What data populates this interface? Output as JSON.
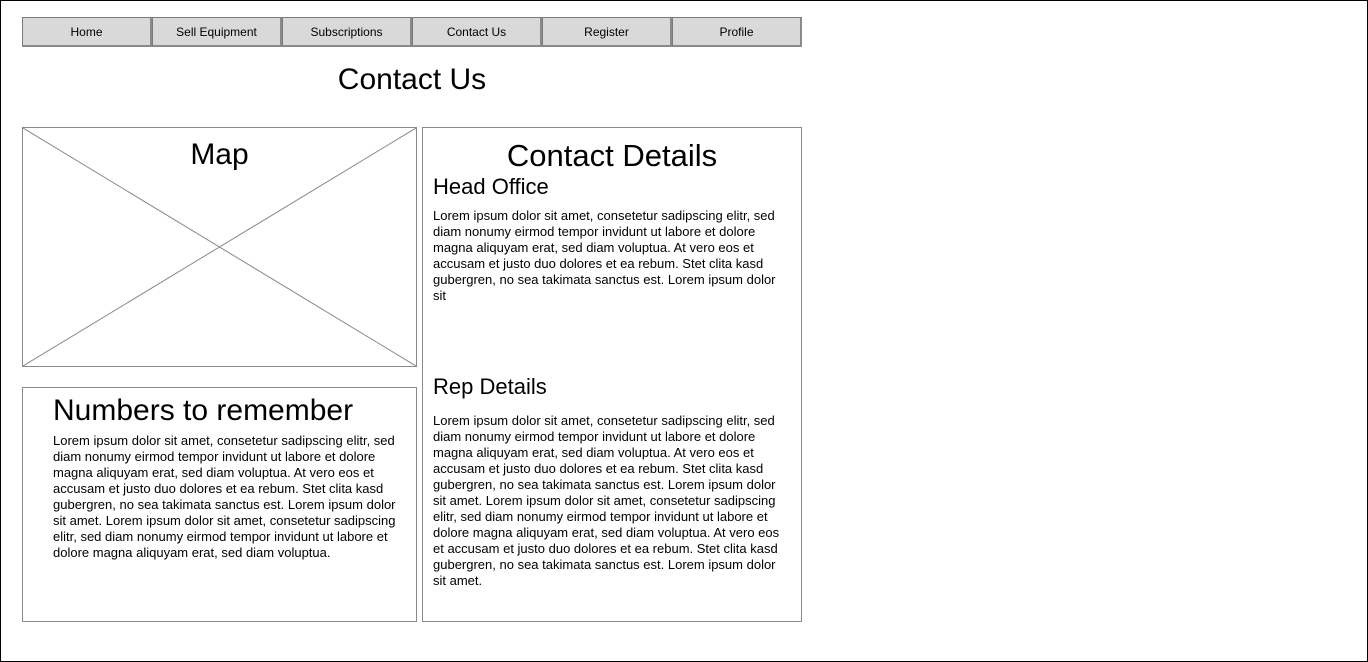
{
  "nav": {
    "items": [
      "Home",
      "Sell Equipment",
      "Subscriptions",
      "Contact Us",
      "Register",
      "Profile"
    ]
  },
  "page": {
    "title": "Contact Us"
  },
  "map": {
    "title": "Map",
    "placeholder_icon": "image-placeholder-icon"
  },
  "numbers": {
    "title": "Numbers to remember",
    "text": "Lorem ipsum dolor sit amet, consetetur sadipscing elitr, sed diam nonumy eirmod tempor invidunt ut labore et dolore magna aliquyam erat, sed diam voluptua. At vero eos et accusam et justo duo dolores et ea rebum. Stet clita kasd gubergren, no sea takimata sanctus est. Lorem ipsum dolor sit amet. Lorem ipsum dolor sit amet, consetetur sadipscing elitr, sed diam nonumy eirmod tempor invidunt ut labore et dolore magna aliquyam erat, sed diam voluptua."
  },
  "contact": {
    "title": "Contact Details",
    "head_office": {
      "title": "Head Office",
      "text": "Lorem ipsum dolor sit amet, consetetur sadipscing elitr, sed diam nonumy eirmod tempor invidunt ut labore et dolore magna aliquyam erat, sed diam voluptua. At vero eos et accusam et justo duo dolores et ea rebum. Stet clita kasd gubergren, no sea takimata sanctus est. Lorem ipsum dolor sit"
    },
    "rep": {
      "title": "Rep Details",
      "text": "Lorem ipsum dolor sit amet, consetetur sadipscing elitr, sed diam nonumy eirmod tempor invidunt ut labore et dolore magna aliquyam erat, sed diam voluptua. At vero eos et accusam et justo duo dolores et ea rebum. Stet clita kasd gubergren, no sea takimata sanctus est. Lorem ipsum dolor sit amet. Lorem ipsum dolor sit amet, consetetur sadipscing elitr, sed diam nonumy eirmod tempor invidunt ut labore et dolore magna aliquyam erat, sed diam voluptua. At vero eos et accusam et justo duo dolores et ea rebum. Stet clita kasd gubergren, no sea takimata sanctus est. Lorem ipsum dolor sit amet."
    }
  }
}
